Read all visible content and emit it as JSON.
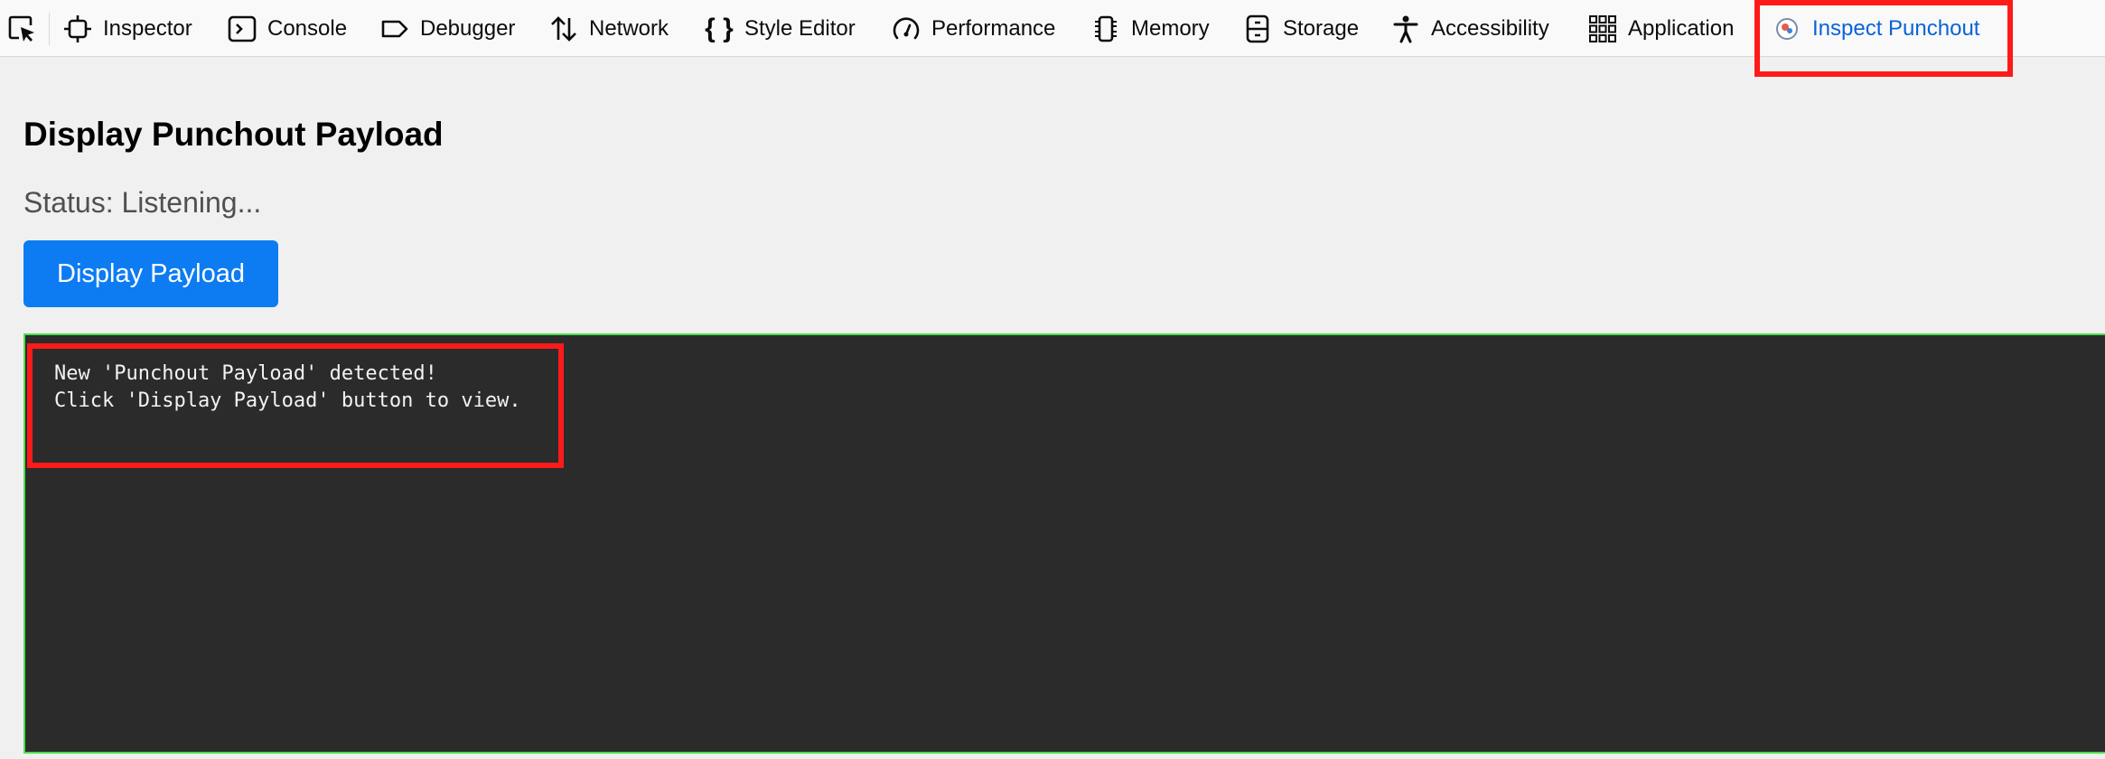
{
  "toolbar": {
    "tabs": [
      {
        "label": "Inspector",
        "icon": "inspector-icon"
      },
      {
        "label": "Console",
        "icon": "console-icon"
      },
      {
        "label": "Debugger",
        "icon": "debugger-icon"
      },
      {
        "label": "Network",
        "icon": "network-icon"
      },
      {
        "label": "Style Editor",
        "icon": "style-editor-icon"
      },
      {
        "label": "Performance",
        "icon": "performance-icon"
      },
      {
        "label": "Memory",
        "icon": "memory-icon"
      },
      {
        "label": "Storage",
        "icon": "storage-icon"
      },
      {
        "label": "Accessibility",
        "icon": "accessibility-icon"
      },
      {
        "label": "Application",
        "icon": "application-icon"
      },
      {
        "label": "Inspect Punchout",
        "icon": "punchout-extension-icon",
        "selected": true
      }
    ]
  },
  "main": {
    "title": "Display Punchout Payload",
    "status": "Status: Listening...",
    "button_label": "Display Payload",
    "output": "New 'Punchout Payload' detected!\nClick 'Display Payload' button to view."
  },
  "colors": {
    "selected_tab": "#0a63d6",
    "button": "#0d7cf2",
    "output_bg": "#2b2b2b",
    "output_border": "#4ade4a",
    "annotation": "#ff1a1a"
  }
}
